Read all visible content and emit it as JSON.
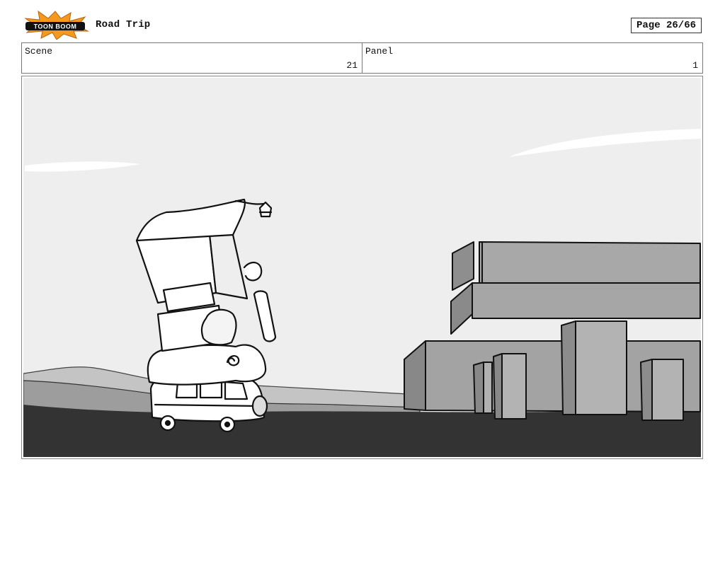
{
  "header": {
    "logo_text": "TOON BOOM",
    "project_title": "Road Trip",
    "page_label": "Page 26/66"
  },
  "scene": {
    "label": "Scene",
    "value": "21"
  },
  "panel": {
    "label": "Panel",
    "value": "1"
  },
  "colors": {
    "logo_orange": "#f39a1e",
    "sky": "#eeeeee",
    "road": "#333333",
    "hills": "#aaaaaa",
    "buildings": "#a3a3a3",
    "outline": "#111111"
  }
}
